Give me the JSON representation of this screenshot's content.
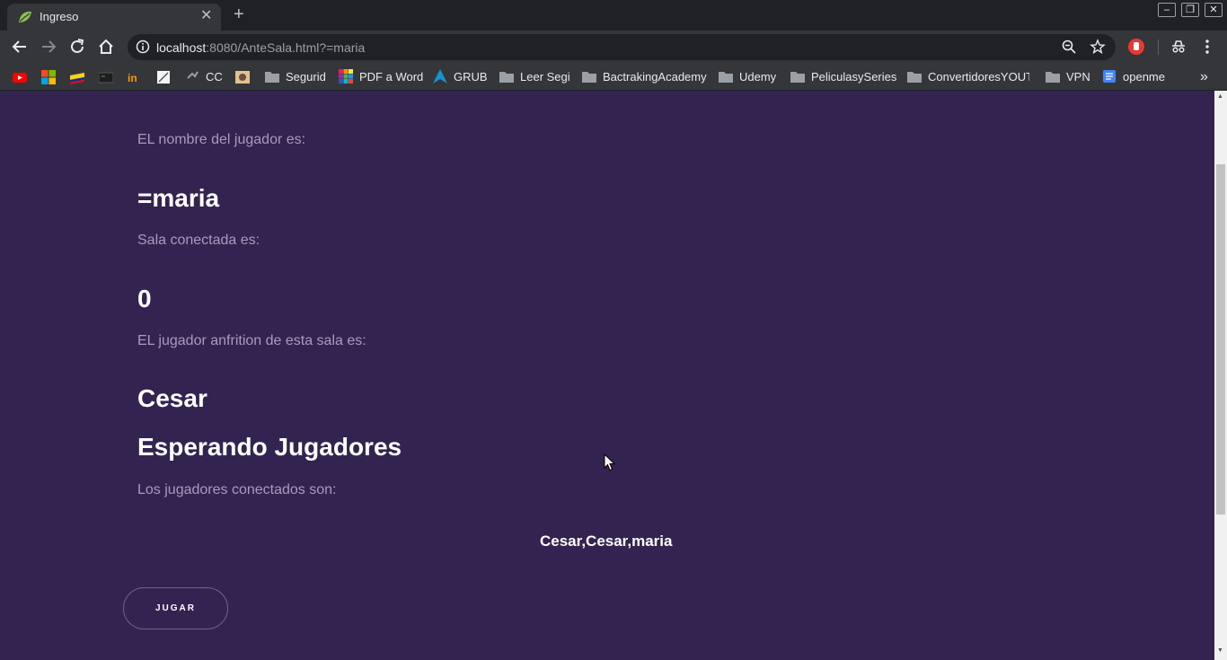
{
  "browser": {
    "tab_title": "Ingreso",
    "tab_close": "✕",
    "new_tab": "+",
    "url_host": "localhost",
    "url_rest": ":8080/AnteSala.html?=maria",
    "window_controls": {
      "minimize": "–",
      "restore": "❐",
      "close": "✕"
    }
  },
  "bookmarks": [
    {
      "label": "CC"
    },
    {
      "label": "Segurid"
    },
    {
      "label": "PDF a Word"
    },
    {
      "label": "GRUB"
    },
    {
      "label": "Leer Segi"
    },
    {
      "label": "BactrakingAcademy"
    },
    {
      "label": "Udemy"
    },
    {
      "label": "PeliculasySeries"
    },
    {
      "label": "ConvertidoresYOUT"
    },
    {
      "label": "VPN"
    },
    {
      "label": "openme"
    }
  ],
  "bookmarks_more": "»",
  "page": {
    "player_label": "EL nombre del jugador es:",
    "player_name": "=maria",
    "room_label": "Sala conectada es:",
    "room_number": "0",
    "host_label": "EL jugador anfrition de esta sala es:",
    "host_name": "Cesar",
    "waiting_text": "Esperando Jugadores",
    "connected_label": "Los jugadores conectados son:",
    "connected_players": "Cesar,Cesar,maria",
    "play_button": "JUGAR"
  },
  "colors": {
    "page_background": "#322350",
    "label_text": "#a49dbb",
    "heading_text": "#ffffff",
    "chrome_dark": "#202124",
    "chrome_toolbar": "#35363a"
  }
}
